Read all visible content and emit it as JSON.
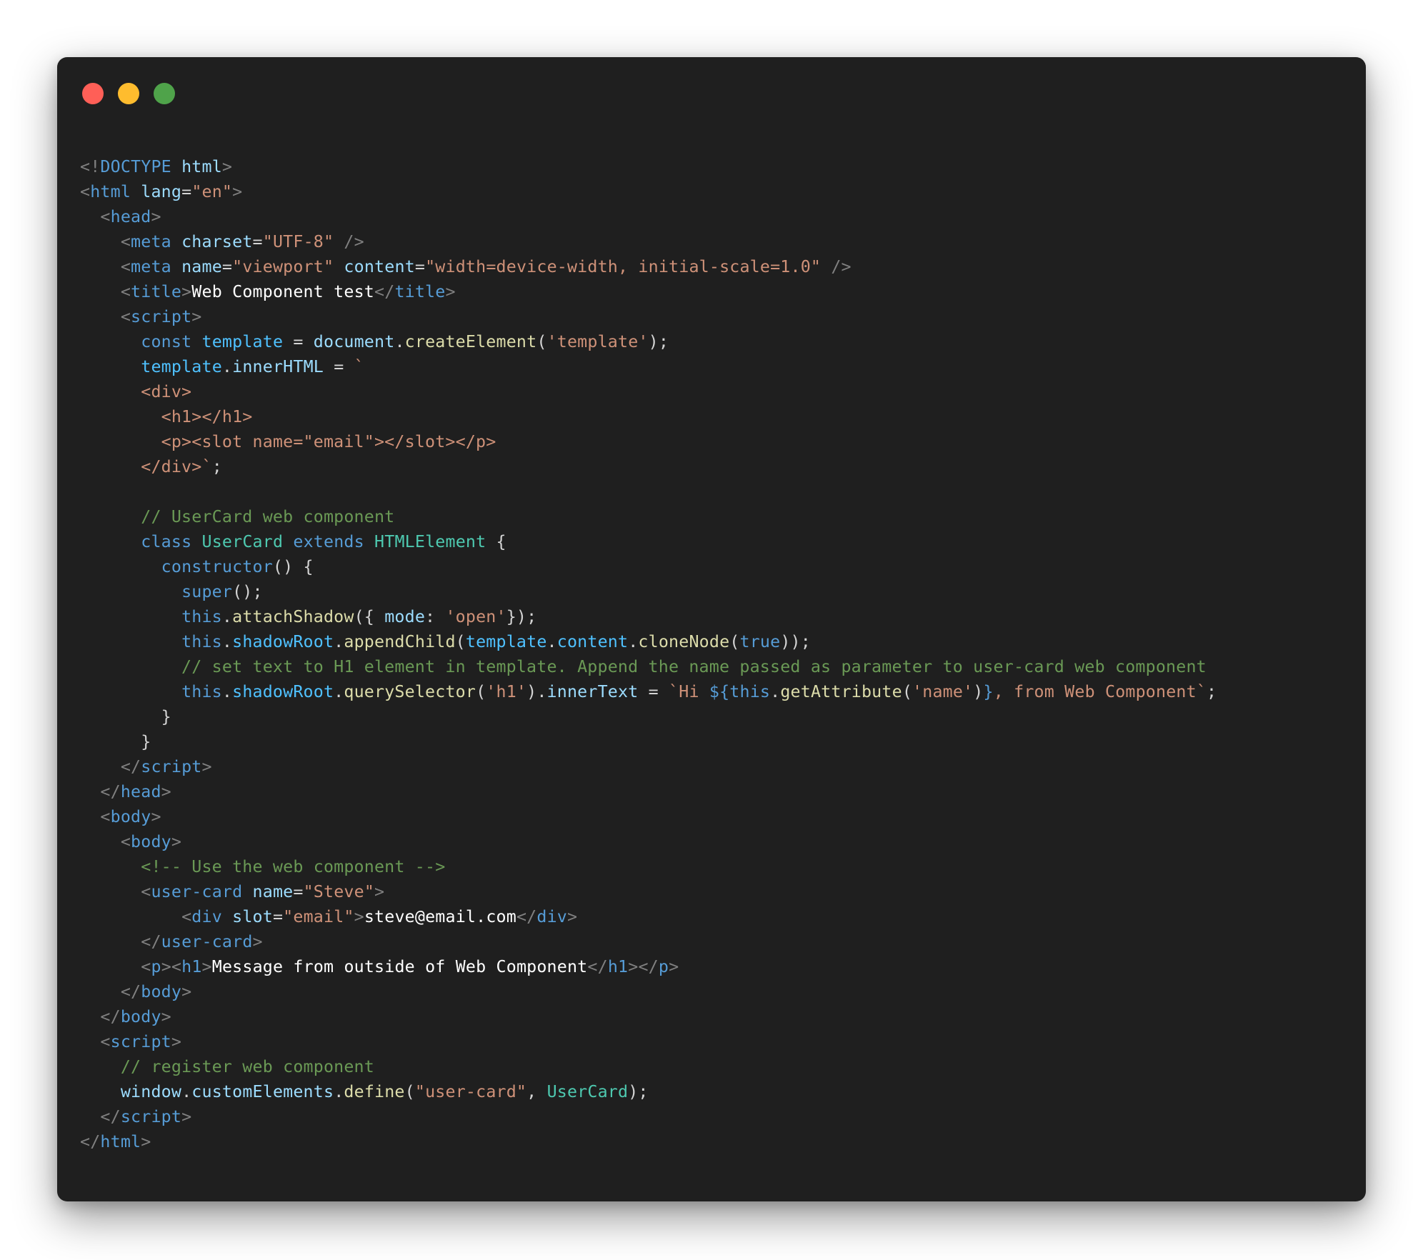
{
  "window": {
    "controls": [
      {
        "name": "close-dot",
        "color": "#ff5f57"
      },
      {
        "name": "minimize-dot",
        "color": "#febc2e"
      },
      {
        "name": "maximize-dot",
        "color": "#4fa34a"
      }
    ]
  },
  "code": {
    "lines": [
      [
        {
          "t": "<!",
          "c": "tag"
        },
        {
          "t": "DOCTYPE",
          "c": "tagname"
        },
        {
          "t": " ",
          "c": "plain"
        },
        {
          "t": "html",
          "c": "attr"
        },
        {
          "t": ">",
          "c": "tag"
        }
      ],
      [
        {
          "t": "<",
          "c": "tag"
        },
        {
          "t": "html",
          "c": "tagname"
        },
        {
          "t": " ",
          "c": "plain"
        },
        {
          "t": "lang",
          "c": "attr"
        },
        {
          "t": "=",
          "c": "plain"
        },
        {
          "t": "\"en\"",
          "c": "str"
        },
        {
          "t": ">",
          "c": "tag"
        }
      ],
      [
        {
          "t": "  ",
          "c": "plain"
        },
        {
          "t": "<",
          "c": "tag"
        },
        {
          "t": "head",
          "c": "tagname"
        },
        {
          "t": ">",
          "c": "tag"
        }
      ],
      [
        {
          "t": "    ",
          "c": "plain"
        },
        {
          "t": "<",
          "c": "tag"
        },
        {
          "t": "meta",
          "c": "tagname"
        },
        {
          "t": " ",
          "c": "plain"
        },
        {
          "t": "charset",
          "c": "attr"
        },
        {
          "t": "=",
          "c": "plain"
        },
        {
          "t": "\"UTF-8\"",
          "c": "str"
        },
        {
          "t": " />",
          "c": "tag"
        }
      ],
      [
        {
          "t": "    ",
          "c": "plain"
        },
        {
          "t": "<",
          "c": "tag"
        },
        {
          "t": "meta",
          "c": "tagname"
        },
        {
          "t": " ",
          "c": "plain"
        },
        {
          "t": "name",
          "c": "attr"
        },
        {
          "t": "=",
          "c": "plain"
        },
        {
          "t": "\"viewport\"",
          "c": "str"
        },
        {
          "t": " ",
          "c": "plain"
        },
        {
          "t": "content",
          "c": "attr"
        },
        {
          "t": "=",
          "c": "plain"
        },
        {
          "t": "\"width=device-width, initial-scale=1.0\"",
          "c": "str"
        },
        {
          "t": " />",
          "c": "tag"
        }
      ],
      [
        {
          "t": "    ",
          "c": "plain"
        },
        {
          "t": "<",
          "c": "tag"
        },
        {
          "t": "title",
          "c": "tagname"
        },
        {
          "t": ">",
          "c": "tag"
        },
        {
          "t": "Web Component test",
          "c": "text"
        },
        {
          "t": "</",
          "c": "tag"
        },
        {
          "t": "title",
          "c": "tagname"
        },
        {
          "t": ">",
          "c": "tag"
        }
      ],
      [
        {
          "t": "    ",
          "c": "plain"
        },
        {
          "t": "<",
          "c": "tag"
        },
        {
          "t": "script",
          "c": "tagname"
        },
        {
          "t": ">",
          "c": "tag"
        }
      ],
      [
        {
          "t": "      ",
          "c": "plain"
        },
        {
          "t": "const",
          "c": "kw"
        },
        {
          "t": " ",
          "c": "plain"
        },
        {
          "t": "template",
          "c": "prop"
        },
        {
          "t": " = ",
          "c": "plain"
        },
        {
          "t": "document",
          "c": "var"
        },
        {
          "t": ".",
          "c": "plain"
        },
        {
          "t": "createElement",
          "c": "fn"
        },
        {
          "t": "(",
          "c": "plain"
        },
        {
          "t": "'template'",
          "c": "str"
        },
        {
          "t": ");",
          "c": "plain"
        }
      ],
      [
        {
          "t": "      ",
          "c": "plain"
        },
        {
          "t": "template",
          "c": "prop"
        },
        {
          "t": ".",
          "c": "plain"
        },
        {
          "t": "innerHTML",
          "c": "var"
        },
        {
          "t": " = ",
          "c": "plain"
        },
        {
          "t": "`",
          "c": "tpl"
        }
      ],
      [
        {
          "t": "      <div>",
          "c": "tpl"
        }
      ],
      [
        {
          "t": "        <h1></h1>",
          "c": "tpl"
        }
      ],
      [
        {
          "t": "        <p><slot name=\"email\"></slot></p>",
          "c": "tpl"
        }
      ],
      [
        {
          "t": "      </div>`",
          "c": "tpl"
        },
        {
          "t": ";",
          "c": "plain"
        }
      ],
      [],
      [
        {
          "t": "      // UserCard web component",
          "c": "cmt"
        }
      ],
      [
        {
          "t": "      ",
          "c": "plain"
        },
        {
          "t": "class",
          "c": "kw"
        },
        {
          "t": " ",
          "c": "plain"
        },
        {
          "t": "UserCard",
          "c": "cls"
        },
        {
          "t": " ",
          "c": "plain"
        },
        {
          "t": "extends",
          "c": "kw"
        },
        {
          "t": " ",
          "c": "plain"
        },
        {
          "t": "HTMLElement",
          "c": "cls"
        },
        {
          "t": " {",
          "c": "plain"
        }
      ],
      [
        {
          "t": "        ",
          "c": "plain"
        },
        {
          "t": "constructor",
          "c": "kw"
        },
        {
          "t": "() {",
          "c": "plain"
        }
      ],
      [
        {
          "t": "          ",
          "c": "plain"
        },
        {
          "t": "super",
          "c": "kw"
        },
        {
          "t": "();",
          "c": "plain"
        }
      ],
      [
        {
          "t": "          ",
          "c": "plain"
        },
        {
          "t": "this",
          "c": "kw"
        },
        {
          "t": ".",
          "c": "plain"
        },
        {
          "t": "attachShadow",
          "c": "fn"
        },
        {
          "t": "({ ",
          "c": "plain"
        },
        {
          "t": "mode",
          "c": "var"
        },
        {
          "t": ": ",
          "c": "plain"
        },
        {
          "t": "'open'",
          "c": "str"
        },
        {
          "t": "});",
          "c": "plain"
        }
      ],
      [
        {
          "t": "          ",
          "c": "plain"
        },
        {
          "t": "this",
          "c": "kw"
        },
        {
          "t": ".",
          "c": "plain"
        },
        {
          "t": "shadowRoot",
          "c": "prop"
        },
        {
          "t": ".",
          "c": "plain"
        },
        {
          "t": "appendChild",
          "c": "fn"
        },
        {
          "t": "(",
          "c": "plain"
        },
        {
          "t": "template",
          "c": "prop"
        },
        {
          "t": ".",
          "c": "plain"
        },
        {
          "t": "content",
          "c": "prop"
        },
        {
          "t": ".",
          "c": "plain"
        },
        {
          "t": "cloneNode",
          "c": "fn"
        },
        {
          "t": "(",
          "c": "plain"
        },
        {
          "t": "true",
          "c": "kw"
        },
        {
          "t": "));",
          "c": "plain"
        }
      ],
      [
        {
          "t": "          // set text to H1 element in template. Append the name passed as parameter to user-card web component",
          "c": "cmt"
        }
      ],
      [
        {
          "t": "          ",
          "c": "plain"
        },
        {
          "t": "this",
          "c": "kw"
        },
        {
          "t": ".",
          "c": "plain"
        },
        {
          "t": "shadowRoot",
          "c": "prop"
        },
        {
          "t": ".",
          "c": "plain"
        },
        {
          "t": "querySelector",
          "c": "fn"
        },
        {
          "t": "(",
          "c": "plain"
        },
        {
          "t": "'h1'",
          "c": "str"
        },
        {
          "t": ").",
          "c": "plain"
        },
        {
          "t": "innerText",
          "c": "var"
        },
        {
          "t": " = ",
          "c": "plain"
        },
        {
          "t": "`Hi ",
          "c": "tpl"
        },
        {
          "t": "${",
          "c": "interp"
        },
        {
          "t": "this",
          "c": "kw"
        },
        {
          "t": ".",
          "c": "plain"
        },
        {
          "t": "getAttribute",
          "c": "fn"
        },
        {
          "t": "(",
          "c": "plain"
        },
        {
          "t": "'name'",
          "c": "str"
        },
        {
          "t": ")",
          "c": "plain"
        },
        {
          "t": "}",
          "c": "interp"
        },
        {
          "t": ", from Web Component`",
          "c": "tpl"
        },
        {
          "t": ";",
          "c": "plain"
        }
      ],
      [
        {
          "t": "        }",
          "c": "plain"
        }
      ],
      [
        {
          "t": "      }",
          "c": "plain"
        }
      ],
      [
        {
          "t": "    ",
          "c": "plain"
        },
        {
          "t": "</",
          "c": "tag"
        },
        {
          "t": "script",
          "c": "tagname"
        },
        {
          "t": ">",
          "c": "tag"
        }
      ],
      [
        {
          "t": "  ",
          "c": "plain"
        },
        {
          "t": "</",
          "c": "tag"
        },
        {
          "t": "head",
          "c": "tagname"
        },
        {
          "t": ">",
          "c": "tag"
        }
      ],
      [
        {
          "t": "  ",
          "c": "plain"
        },
        {
          "t": "<",
          "c": "tag"
        },
        {
          "t": "body",
          "c": "tagname"
        },
        {
          "t": ">",
          "c": "tag"
        }
      ],
      [
        {
          "t": "    ",
          "c": "plain"
        },
        {
          "t": "<",
          "c": "tag"
        },
        {
          "t": "body",
          "c": "tagname"
        },
        {
          "t": ">",
          "c": "tag"
        }
      ],
      [
        {
          "t": "      <!-- Use the web component -->",
          "c": "cmt"
        }
      ],
      [
        {
          "t": "      ",
          "c": "plain"
        },
        {
          "t": "<",
          "c": "tag"
        },
        {
          "t": "user-card",
          "c": "tagname"
        },
        {
          "t": " ",
          "c": "plain"
        },
        {
          "t": "name",
          "c": "attr"
        },
        {
          "t": "=",
          "c": "plain"
        },
        {
          "t": "\"Steve\"",
          "c": "str"
        },
        {
          "t": ">",
          "c": "tag"
        }
      ],
      [
        {
          "t": "          ",
          "c": "plain"
        },
        {
          "t": "<",
          "c": "tag"
        },
        {
          "t": "div",
          "c": "tagname"
        },
        {
          "t": " ",
          "c": "plain"
        },
        {
          "t": "slot",
          "c": "attr"
        },
        {
          "t": "=",
          "c": "plain"
        },
        {
          "t": "\"email\"",
          "c": "str"
        },
        {
          "t": ">",
          "c": "tag"
        },
        {
          "t": "steve@email.com",
          "c": "text"
        },
        {
          "t": "</",
          "c": "tag"
        },
        {
          "t": "div",
          "c": "tagname"
        },
        {
          "t": ">",
          "c": "tag"
        }
      ],
      [
        {
          "t": "      ",
          "c": "plain"
        },
        {
          "t": "</",
          "c": "tag"
        },
        {
          "t": "user-card",
          "c": "tagname"
        },
        {
          "t": ">",
          "c": "tag"
        }
      ],
      [
        {
          "t": "      ",
          "c": "plain"
        },
        {
          "t": "<",
          "c": "tag"
        },
        {
          "t": "p",
          "c": "tagname"
        },
        {
          "t": ">",
          "c": "tag"
        },
        {
          "t": "<",
          "c": "tag"
        },
        {
          "t": "h1",
          "c": "tagname"
        },
        {
          "t": ">",
          "c": "tag"
        },
        {
          "t": "Message from outside of Web Component",
          "c": "text"
        },
        {
          "t": "</",
          "c": "tag"
        },
        {
          "t": "h1",
          "c": "tagname"
        },
        {
          "t": ">",
          "c": "tag"
        },
        {
          "t": "</",
          "c": "tag"
        },
        {
          "t": "p",
          "c": "tagname"
        },
        {
          "t": ">",
          "c": "tag"
        }
      ],
      [
        {
          "t": "    ",
          "c": "plain"
        },
        {
          "t": "</",
          "c": "tag"
        },
        {
          "t": "body",
          "c": "tagname"
        },
        {
          "t": ">",
          "c": "tag"
        }
      ],
      [
        {
          "t": "  ",
          "c": "plain"
        },
        {
          "t": "</",
          "c": "tag"
        },
        {
          "t": "body",
          "c": "tagname"
        },
        {
          "t": ">",
          "c": "tag"
        }
      ],
      [
        {
          "t": "  ",
          "c": "plain"
        },
        {
          "t": "<",
          "c": "tag"
        },
        {
          "t": "script",
          "c": "tagname"
        },
        {
          "t": ">",
          "c": "tag"
        }
      ],
      [
        {
          "t": "    // register web component",
          "c": "cmt"
        }
      ],
      [
        {
          "t": "    ",
          "c": "plain"
        },
        {
          "t": "window",
          "c": "var"
        },
        {
          "t": ".",
          "c": "plain"
        },
        {
          "t": "customElements",
          "c": "var"
        },
        {
          "t": ".",
          "c": "plain"
        },
        {
          "t": "define",
          "c": "fn"
        },
        {
          "t": "(",
          "c": "plain"
        },
        {
          "t": "\"user-card\"",
          "c": "str"
        },
        {
          "t": ", ",
          "c": "plain"
        },
        {
          "t": "UserCard",
          "c": "cls"
        },
        {
          "t": ");",
          "c": "plain"
        }
      ],
      [
        {
          "t": "  ",
          "c": "plain"
        },
        {
          "t": "</",
          "c": "tag"
        },
        {
          "t": "script",
          "c": "tagname"
        },
        {
          "t": ">",
          "c": "tag"
        }
      ],
      [
        {
          "t": "</",
          "c": "tag"
        },
        {
          "t": "html",
          "c": "tagname"
        },
        {
          "t": ">",
          "c": "tag"
        }
      ]
    ]
  }
}
